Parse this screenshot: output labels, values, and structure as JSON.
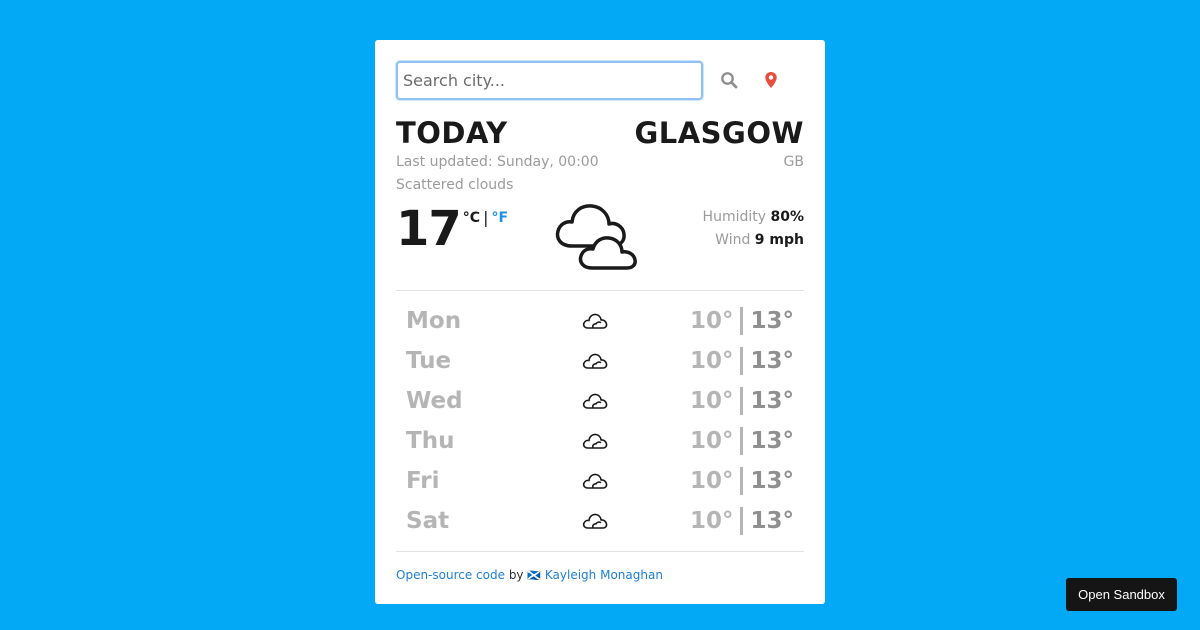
{
  "search": {
    "placeholder": "Search city..."
  },
  "today": {
    "heading": "TODAY",
    "last_updated": "Last updated: Sunday, 00:00",
    "description": "Scattered clouds",
    "temperature": "17",
    "unit_c": "°C",
    "unit_sep": "|",
    "unit_f": "°F",
    "humidity_label": "Humidity",
    "humidity_value": "80%",
    "wind_label": "Wind",
    "wind_value": "9 mph",
    "icon": "scattered-clouds-icon"
  },
  "location": {
    "city": "GLASGOW",
    "country": "GB"
  },
  "forecast": [
    {
      "day": "Mon",
      "min": "10°",
      "max": "13°",
      "icon": "cloud-icon"
    },
    {
      "day": "Tue",
      "min": "10°",
      "max": "13°",
      "icon": "cloud-icon"
    },
    {
      "day": "Wed",
      "min": "10°",
      "max": "13°",
      "icon": "cloud-icon"
    },
    {
      "day": "Thu",
      "min": "10°",
      "max": "13°",
      "icon": "cloud-icon"
    },
    {
      "day": "Fri",
      "min": "10°",
      "max": "13°",
      "icon": "cloud-icon"
    },
    {
      "day": "Sat",
      "min": "10°",
      "max": "13°",
      "icon": "cloud-icon"
    }
  ],
  "footer": {
    "code_link": "Open-source code",
    "by": "by",
    "flag": "🏴󠁧󠁢󠁳󠁣󠁴󠁿",
    "author_link": "Kayleigh Monaghan"
  },
  "sandbox_button": "Open Sandbox",
  "colors": {
    "background": "#03a9f4",
    "link": "#1e7fd6",
    "active_unit": "#1e90e6",
    "location_pin": "#e74c3c"
  }
}
